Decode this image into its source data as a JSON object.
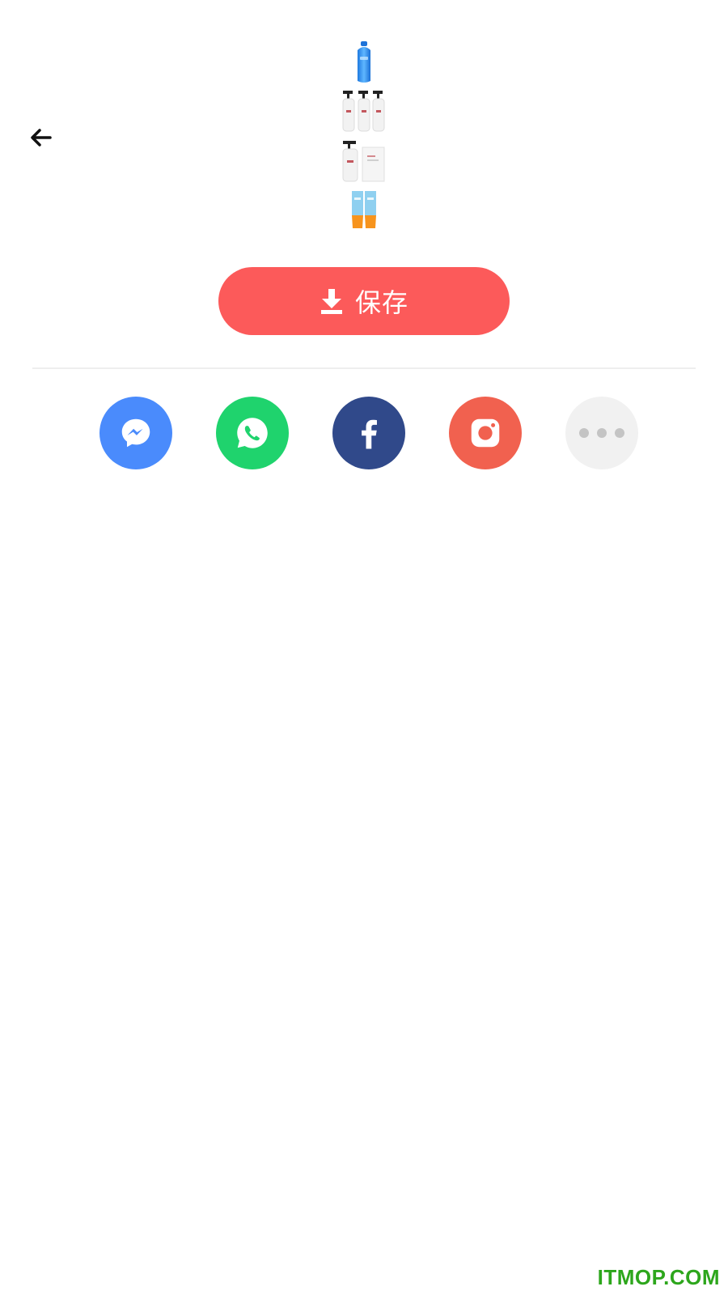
{
  "header": {
    "back_icon": "arrow-left-icon"
  },
  "preview": {
    "thumbnails": [
      {
        "name": "blue-bottle",
        "icon": "product-bottle-icon"
      },
      {
        "name": "pump-bottles-trio",
        "icon": "product-pump-bottles-icon"
      },
      {
        "name": "pump-bottle-and-box",
        "icon": "product-pump-box-icon"
      },
      {
        "name": "sunscreen-tubes",
        "icon": "product-tubes-icon"
      }
    ]
  },
  "save": {
    "label": "保存",
    "icon": "download-icon",
    "color": "#fc5a5a"
  },
  "share": {
    "targets": [
      {
        "name": "messenger",
        "icon": "messenger-icon",
        "color": "#4a8bfc"
      },
      {
        "name": "whatsapp",
        "icon": "whatsapp-icon",
        "color": "#1fd36d"
      },
      {
        "name": "facebook",
        "icon": "facebook-icon",
        "color": "#30498a"
      },
      {
        "name": "instagram",
        "icon": "instagram-icon",
        "color": "#f1614f"
      },
      {
        "name": "more",
        "icon": "more-dots-icon",
        "color": "#f1f1f1"
      }
    ]
  },
  "watermark": {
    "text": "ITMOP.COM",
    "color": "#2da61c"
  }
}
